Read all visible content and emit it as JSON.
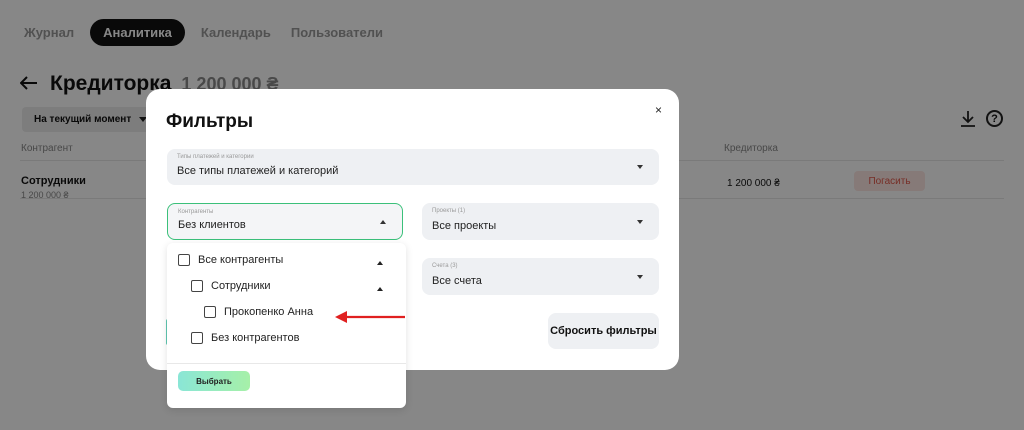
{
  "nav": {
    "tabs": [
      {
        "label": "Журнал"
      },
      {
        "label": "Аналитика",
        "active": true
      },
      {
        "label": "Календарь"
      },
      {
        "label": "Пользователи"
      }
    ]
  },
  "page": {
    "title": "Кредиторка",
    "total": "1 200 000 ₴",
    "period_button": "На текущий момент",
    "columns": {
      "counterparty": "Контрагент",
      "payable": "Кредиторка"
    },
    "rows": [
      {
        "name": "Сотрудники",
        "sub": "1 200 000 ₴",
        "amount": "1 200 000 ₴",
        "action": "Погасить"
      }
    ],
    "icons": {
      "back": "arrow-left-icon",
      "download": "download-icon",
      "help": "help-circle-icon"
    }
  },
  "modal": {
    "title": "Фильтры",
    "close": "×",
    "payment_types": {
      "label": "Типы платежей и категории",
      "value": "Все типы платежей и категорий"
    },
    "counterparties": {
      "label": "Контрагенты",
      "value": "Без клиентов"
    },
    "projects": {
      "label": "Проекты (1)",
      "value": "Все проекты"
    },
    "accounts": {
      "label": "Счета (3)",
      "value": "Все счета"
    },
    "reset_button": "Сбросить фильтры"
  },
  "dropdown": {
    "options": [
      {
        "label": "Все контрагенты",
        "checked": false,
        "level": 0,
        "expanded": true
      },
      {
        "label": "Сотрудники",
        "checked": false,
        "level": 1,
        "expanded": true
      },
      {
        "label": "Прокопенко Анна",
        "checked": false,
        "level": 2
      },
      {
        "label": "Без контрагентов",
        "checked": false,
        "level": 1
      }
    ],
    "select_button": "Выбрать"
  },
  "colors": {
    "accent_green": "#3bc07a",
    "annotation_red": "#e02020",
    "pay_button_text": "#e0574a"
  }
}
